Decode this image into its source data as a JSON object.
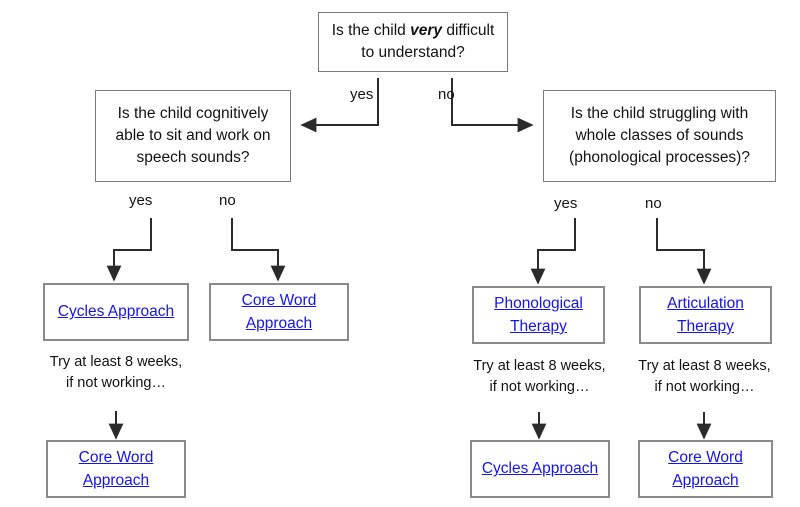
{
  "diagram": {
    "title": "Speech sound disorder treatment decision flowchart",
    "background": "#ffffff",
    "link_color": "#1414ee",
    "box_border_color": "#8a8a8a",
    "line_color": "#2b2b2b"
  },
  "nodes": {
    "root_question": {
      "kind": "question",
      "line1_pre": "Is the child ",
      "line1_em": "very",
      "line1_post": " difficult",
      "line2": "to understand?"
    },
    "left_question": {
      "kind": "question",
      "line1": "Is the child cognitively",
      "line2": "able to sit and work on",
      "line3": "speech sounds?"
    },
    "right_question": {
      "kind": "question",
      "line1": "Is the child struggling with",
      "line2": "whole classes of sounds",
      "line3": "(phonological processes)?"
    },
    "cycles_left": {
      "kind": "outcome",
      "line1": "Cycles Approach"
    },
    "coreword_left": {
      "kind": "outcome",
      "line1": "Core Word",
      "line2": "Approach"
    },
    "coreword_left_final": {
      "kind": "outcome",
      "line1": "Core Word",
      "line2": "Approach"
    },
    "phonological_therapy": {
      "kind": "outcome",
      "line1": "Phonological",
      "line2": "Therapy"
    },
    "articulation_therapy": {
      "kind": "outcome",
      "line1": "Articulation",
      "line2": "Therapy"
    },
    "cycles_right_final": {
      "kind": "outcome",
      "line1": "Cycles Approach"
    },
    "coreword_right_final": {
      "kind": "outcome",
      "line1": "Core Word",
      "line2": "Approach"
    }
  },
  "captions": {
    "left_retry": {
      "line1": "Try at least 8 weeks,",
      "line2": "if not working…"
    },
    "mid_retry": {
      "line1": "Try at least 8 weeks,",
      "line2": "if not working…"
    },
    "right_retry": {
      "line1": "Try at least 8 weeks,",
      "line2": "if not working…"
    }
  },
  "edge_labels": {
    "root_yes": "yes",
    "root_no": "no",
    "left_yes": "yes",
    "left_no": "no",
    "right_yes": "yes",
    "right_no": "no"
  }
}
